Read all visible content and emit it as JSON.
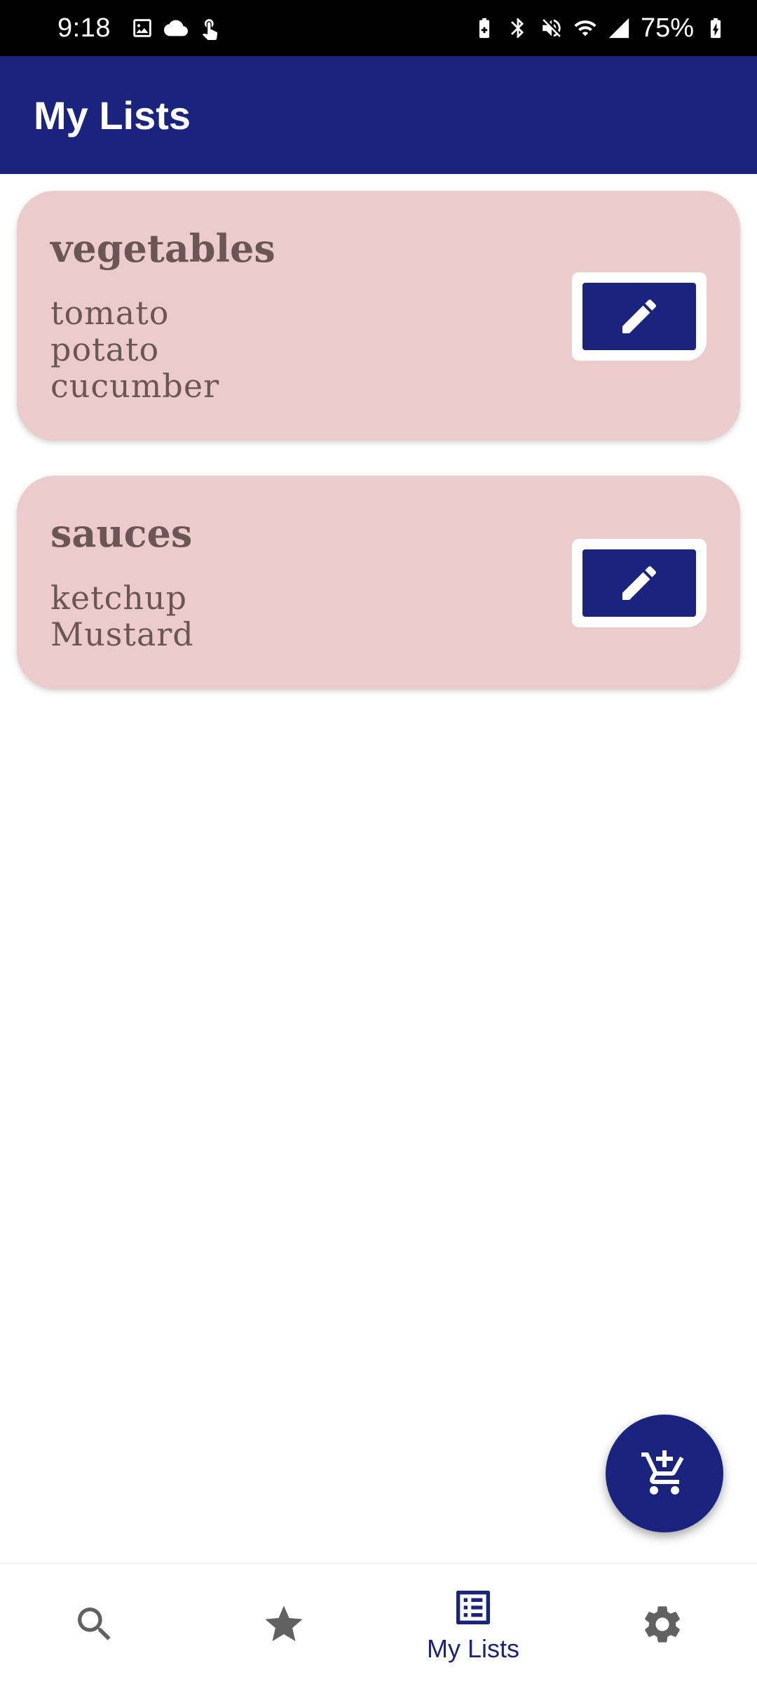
{
  "status_bar": {
    "time": "9:18",
    "battery_text": "75%",
    "icons_left": [
      "gallery-icon",
      "cloud-icon",
      "gesture-icon"
    ],
    "icons_right": [
      "battery-saver-icon",
      "bluetooth-icon",
      "mute-icon",
      "wifi-icon",
      "signal-icon",
      "battery-icon"
    ]
  },
  "app_bar": {
    "title": "My Lists"
  },
  "lists": [
    {
      "title": "vegetables",
      "items": [
        "tomato",
        "potato",
        "cucumber"
      ],
      "edit_icon": "pencil-icon"
    },
    {
      "title": "sauces",
      "items": [
        "ketchup",
        "Mustard"
      ],
      "edit_icon": "pencil-icon"
    }
  ],
  "fab": {
    "icon": "add-to-cart-icon"
  },
  "bottom_nav": {
    "items": [
      {
        "icon": "search-icon",
        "label": ""
      },
      {
        "icon": "star-icon",
        "label": ""
      },
      {
        "icon": "list-icon",
        "label": "My Lists",
        "active": true
      },
      {
        "icon": "gear-icon",
        "label": ""
      }
    ]
  },
  "colors": {
    "primary": "#1a237e",
    "card_background": "#eccbcc",
    "card_text": "#6b5656",
    "inactive_icon": "#616161"
  }
}
